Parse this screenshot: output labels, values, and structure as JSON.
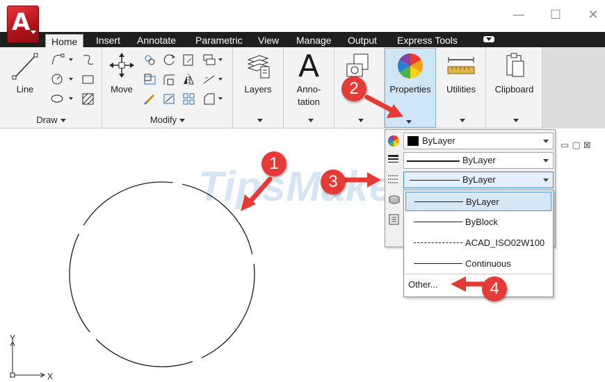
{
  "window": {
    "minimize_label": "—",
    "maximize_label": "☐",
    "close_label": "✕"
  },
  "app_logo": {
    "letter": "A"
  },
  "tabs": [
    {
      "label": "Home",
      "active": true
    },
    {
      "label": "Insert"
    },
    {
      "label": "Annotate"
    },
    {
      "label": "Parametric"
    },
    {
      "label": "View"
    },
    {
      "label": "Manage"
    },
    {
      "label": "Output"
    },
    {
      "label": "Express Tools"
    }
  ],
  "ribbon": {
    "line_label": "Line",
    "move_label": "Move",
    "layers_label": "Layers",
    "annotation_label": "Anno-\ntation",
    "properties_label": "Properties",
    "utilities_label": "Utilities",
    "clipboard_label": "Clipboard",
    "annotation_letter": "A",
    "panels": {
      "draw": "Draw",
      "modify": "Modify"
    }
  },
  "properties_panel": {
    "color_value": "ByLayer",
    "lineweight_value": "ByLayer",
    "linetype_value": "ByLayer"
  },
  "linetype_list": {
    "items": [
      {
        "label": "ByLayer",
        "selected": true,
        "style": "solid"
      },
      {
        "label": "ByBlock",
        "style": "solid"
      },
      {
        "label": "ACAD_ISO02W100",
        "style": "dashed"
      },
      {
        "label": "Continuous",
        "style": "solid"
      }
    ],
    "other_label": "Other..."
  },
  "callouts": [
    "1",
    "2",
    "3",
    "4"
  ],
  "canvas": {
    "watermark": "TipsMake",
    "ucs_y": "Y",
    "ucs_x": "X",
    "viewport_controls": "▭ ▢ ⊠"
  },
  "colors": {
    "callout_red": "#e53a36",
    "tab_bar": "#1f1f1f",
    "highlight_blue": "#cfe6f8",
    "logo_red": "#c8161d"
  }
}
